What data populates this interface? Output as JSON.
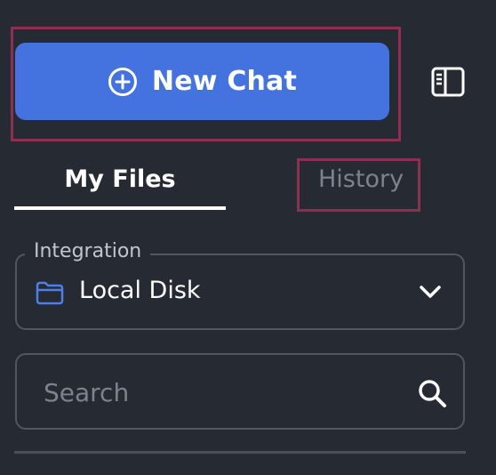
{
  "new_chat": {
    "label": "New Chat",
    "icon": "plus-circle-icon"
  },
  "sidebar_toggle": {
    "icon": "sidebar-panel-icon"
  },
  "tabs": [
    {
      "label": "My Files",
      "active": true
    },
    {
      "label": "History",
      "active": false
    }
  ],
  "integration": {
    "legend": "Integration",
    "value": "Local Disk",
    "icon": "folder-icon",
    "chevron": "chevron-down-icon"
  },
  "search": {
    "placeholder": "Search",
    "value": "",
    "icon": "search-icon"
  },
  "colors": {
    "background": "#252a33",
    "accent": "#4473e0",
    "highlight": "#8e2f51",
    "muted_text": "#7d838e",
    "border": "#51565f"
  }
}
